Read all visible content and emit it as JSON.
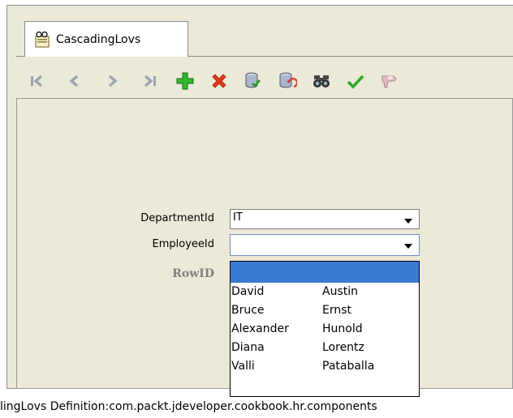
{
  "tab": {
    "label": "CascadingLovs",
    "icon": "document-glasses-icon"
  },
  "toolbar": {
    "buttons": [
      {
        "name": "first-record-button",
        "icon": "first-icon"
      },
      {
        "name": "previous-record-button",
        "icon": "previous-icon"
      },
      {
        "name": "next-record-button",
        "icon": "next-icon"
      },
      {
        "name": "last-record-button",
        "icon": "last-icon"
      },
      {
        "name": "insert-button",
        "icon": "plus-icon"
      },
      {
        "name": "delete-button",
        "icon": "x-icon"
      },
      {
        "name": "commit-button",
        "icon": "database-check-icon"
      },
      {
        "name": "rollback-button",
        "icon": "database-undo-icon"
      },
      {
        "name": "find-button",
        "icon": "binoculars-icon"
      },
      {
        "name": "execute-button",
        "icon": "checkmark-icon"
      },
      {
        "name": "cancel-find-button",
        "icon": "hand-icon"
      }
    ]
  },
  "form": {
    "department_label": "DepartmentId",
    "department_value": "IT",
    "employee_label": "EmployeeId",
    "employee_value": "",
    "rowid_label": "RowID"
  },
  "dropdown": {
    "rows": [
      {
        "first": "David",
        "last": "Austin"
      },
      {
        "first": "Bruce",
        "last": "Ernst"
      },
      {
        "first": "Alexander",
        "last": "Hunold"
      },
      {
        "first": "Diana",
        "last": "Lorentz"
      },
      {
        "first": "Valli",
        "last": "Pataballa"
      }
    ]
  },
  "status": {
    "text": "lingLovs  Definition:com.packt.jdeveloper.cookbook.hr.components"
  }
}
